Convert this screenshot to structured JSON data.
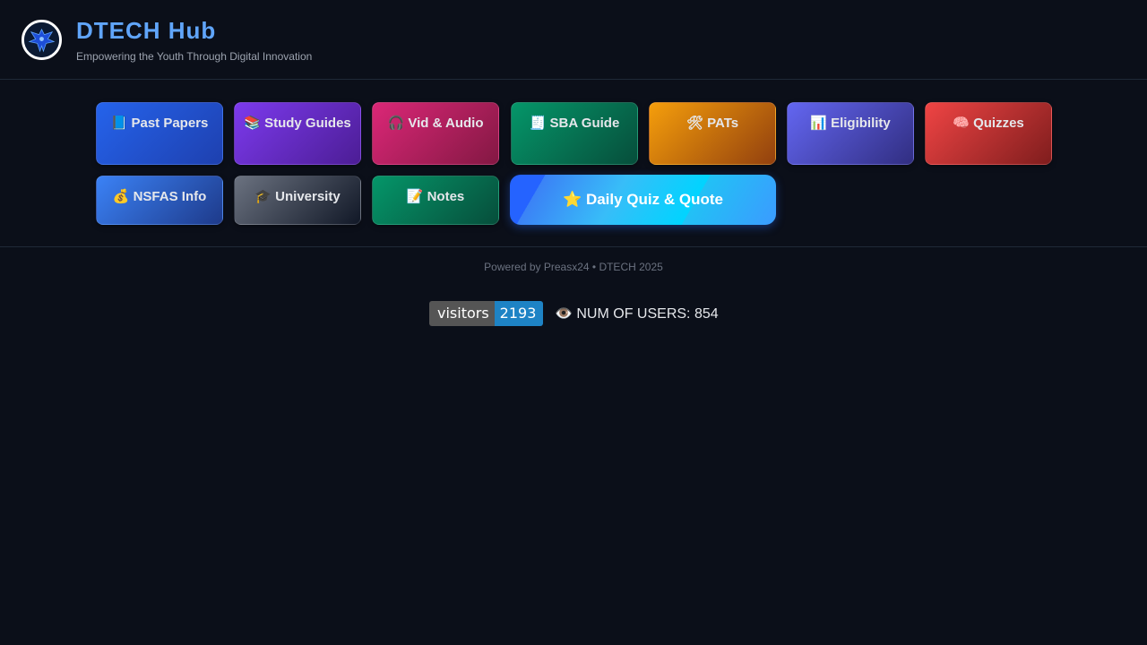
{
  "header": {
    "title": "DTECH Hub",
    "tagline": "Empowering the Youth Through Digital Innovation",
    "logo_icon": "eagle-logo-icon"
  },
  "nav": {
    "past_papers": {
      "icon": "📘",
      "label": "Past Papers",
      "color_from": "#2563eb",
      "color_to": "#1e40af"
    },
    "study_guides": {
      "icon": "📚",
      "label": "Study Guides",
      "color_from": "#7c3aed",
      "color_to": "#4c1d95"
    },
    "vid_audio": {
      "icon": "🎧",
      "label": "Vid & Audio",
      "color_from": "#db2777",
      "color_to": "#831843"
    },
    "sba_guide": {
      "icon": "🧾",
      "label": "SBA Guide",
      "color_from": "#059669",
      "color_to": "#064e3b"
    },
    "pats": {
      "icon": "🛠",
      "label": "PATs",
      "color_from": "#f59e0b",
      "color_to": "#92400e"
    },
    "eligibility": {
      "icon": "📊",
      "label": "Eligibility",
      "color_from": "#6366f1",
      "color_to": "#312e81"
    },
    "quizzes": {
      "icon": "🧠",
      "label": "Quizzes",
      "color_from": "#ef4444",
      "color_to": "#7f1d1d"
    },
    "nsfas_info": {
      "icon": "💰",
      "label": "NSFAS Info",
      "color_from": "#3b82f6",
      "color_to": "#1e3a8a"
    },
    "university": {
      "icon": "🎓",
      "label": "University",
      "color_from": "#6b7280",
      "color_to": "#111827"
    },
    "notes": {
      "icon": "📝",
      "label": "Notes",
      "color_from": "#059669",
      "color_to": "#064e3b"
    }
  },
  "daily": {
    "icon": "⭐",
    "label": "Daily Quiz & Quote"
  },
  "footer": {
    "text": "Powered by Preasx24 • DTECH 2025"
  },
  "stats": {
    "badge_label": "visitors",
    "badge_value": "2193",
    "users_icon": "👁️",
    "users_text": "NUM OF USERS: 854"
  }
}
